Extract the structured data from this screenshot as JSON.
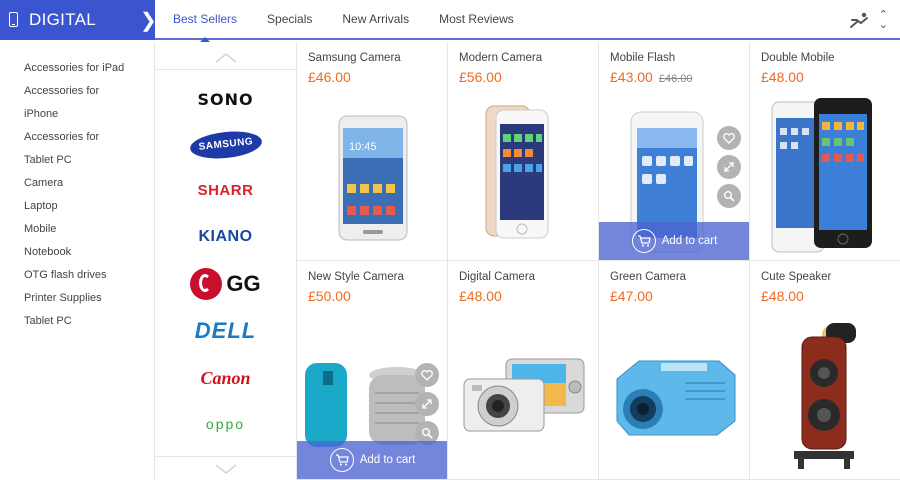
{
  "header": {
    "category": "DIGITAL",
    "tabs": [
      "Best Sellers",
      "Specials",
      "New Arrivals",
      "Most Reviews"
    ],
    "active_tab": "Best Sellers"
  },
  "sidebar": {
    "items": [
      "Accessories for iPad",
      "Accessories for",
      "iPhone",
      "Accessories for",
      "Tablet PC",
      "Camera",
      "Laptop",
      "Mobile",
      "Notebook",
      "OTG flash drives",
      "Printer Supplies",
      "Tablet PC"
    ]
  },
  "brands": {
    "items": [
      {
        "name": "SONO",
        "color": "#111111"
      },
      {
        "name": "SAMSUNG",
        "color": "#1e3aa8"
      },
      {
        "name": "SHARR",
        "color": "#d8232a"
      },
      {
        "name": "KIANO",
        "color": "#1a47a0"
      },
      {
        "name": "GG",
        "color": "#c8102e"
      },
      {
        "name": "DELL",
        "color": "#1a7bc4"
      },
      {
        "name": "Canon",
        "color": "#d0121b"
      },
      {
        "name": "OPPO",
        "color": "#2fae3c"
      }
    ]
  },
  "products": [
    {
      "name": "Samsung Camera",
      "price": "£46.00",
      "old_price": ""
    },
    {
      "name": "Modern Camera",
      "price": "£56.00",
      "old_price": ""
    },
    {
      "name": "Mobile Flash",
      "price": "£43.00",
      "old_price": "£46.00"
    },
    {
      "name": "Double Mobile",
      "price": "£48.00",
      "old_price": ""
    },
    {
      "name": "New Style Camera",
      "price": "£50.00",
      "old_price": ""
    },
    {
      "name": "Digital Camera",
      "price": "£48.00",
      "old_price": ""
    },
    {
      "name": "Green Camera",
      "price": "£47.00",
      "old_price": ""
    },
    {
      "name": "Cute Speaker",
      "price": "£48.00",
      "old_price": ""
    }
  ],
  "add_to_cart_label": "Add to cart",
  "colors": {
    "accent": "#3b55d0",
    "price": "#f06a20",
    "overlay": "#4d64d2"
  }
}
